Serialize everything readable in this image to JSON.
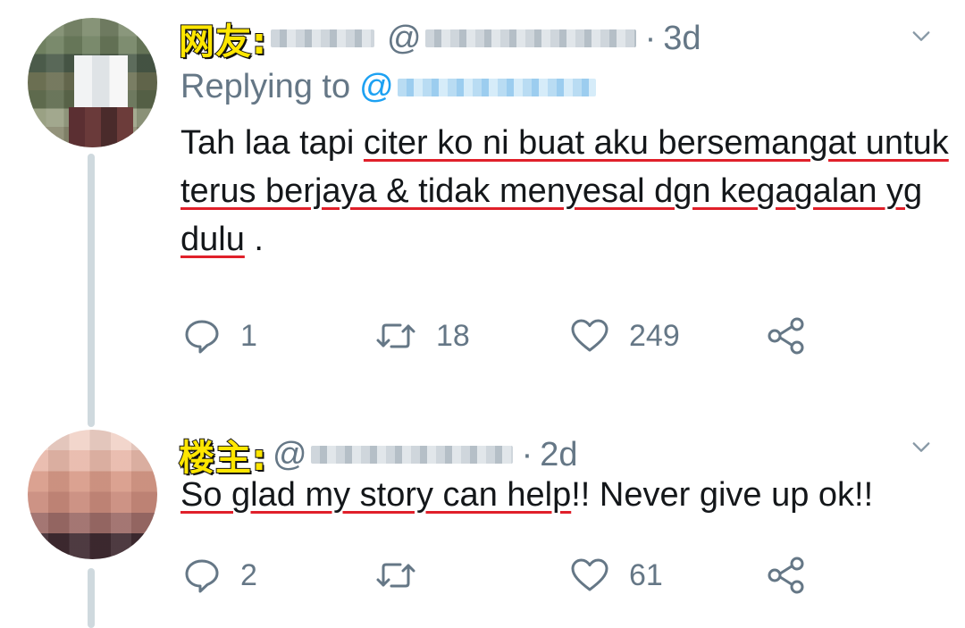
{
  "tweets": [
    {
      "label": "网友:",
      "display_name_visible": "",
      "handle_prefix": "@",
      "separator": "·",
      "time": "3d",
      "replying_to_label": "Replying to",
      "replying_to_prefix": "@",
      "body_underlined_1": "",
      "body_plain_1": "Tah laa tapi ",
      "body_underlined_2": "citer ko ni buat aku bersemangat untuk terus berjaya & tidak menyesal dgn kegagalan yg dulu",
      "body_plain_2": " .",
      "actions": {
        "replies": "1",
        "retweets": "18",
        "likes": "249"
      }
    },
    {
      "label": "楼主:",
      "handle_prefix": "@",
      "separator": "·",
      "time": "2d",
      "body_underlined_1": "So glad my story can help",
      "body_plain_1": "!! Never give up ok!!",
      "actions": {
        "replies": "2",
        "retweets": "",
        "likes": "61"
      }
    }
  ],
  "icons": {
    "reply": "reply-icon",
    "retweet": "retweet-icon",
    "like": "heart-icon",
    "share": "share-icon",
    "menu": "chevron-down-icon"
  },
  "colors": {
    "text": "#14171a",
    "muted": "#657786",
    "link": "#1da1f2",
    "underline": "#e0202a",
    "label_fill": "#ffe600"
  }
}
